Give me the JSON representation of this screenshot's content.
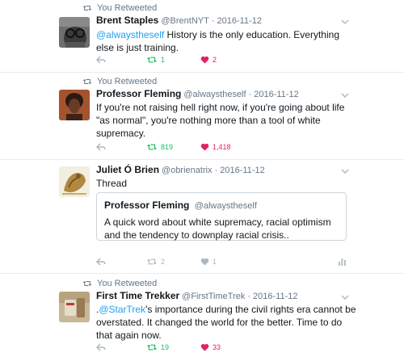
{
  "retweet_label": "You Retweeted",
  "tweets": [
    {
      "retweeted": true,
      "name": "Brent Staples",
      "handle": "@BrentNYT",
      "dot": "·",
      "date": "2016-11-12",
      "text_mention": "@alwaystheself",
      "text_rest": " History is the only education. Everything else is just training.",
      "retweets": "1",
      "likes": "2"
    },
    {
      "retweeted": true,
      "name": "Professor Fleming",
      "handle": "@alwaystheself",
      "dot": "·",
      "date": "2016-11-12",
      "text": "If you're not raising hell right now, if you're going about life \"as normal\", you're nothing more than a tool of white supremacy.",
      "retweets": "819",
      "likes": "1,418"
    },
    {
      "retweeted": false,
      "name": "Juliet Ó Brien",
      "handle": "@obrienatrix",
      "dot": "·",
      "date": "2016-11-12",
      "text": "Thread",
      "quote": {
        "name": "Professor Fleming",
        "handle": "@alwaystheself",
        "text": "A quick word about white supremacy, racial optimism and the tendency to downplay racial crisis.."
      },
      "retweets": "2",
      "likes": "1"
    },
    {
      "retweeted": true,
      "name": "First Time Trekker",
      "handle": "@FirstTimeTrek",
      "dot": "·",
      "date": "2016-11-12",
      "text_pre": ".",
      "text_mention": "@StarTrek",
      "text_rest": "'s importance during the civil rights era cannot be overstated. It changed the world for the better. Time to do that again now.",
      "retweets": "19",
      "likes": "33"
    }
  ],
  "colors": {
    "accent_blue": "#1da1f2",
    "retweet_green": "#17bf63",
    "like_red": "#e0245e",
    "muted": "#657786",
    "icon_gray": "#aab8c2"
  },
  "icons": [
    "retweet-icon",
    "reply-icon",
    "heart-icon",
    "chevron-down-icon",
    "analytics-icon"
  ]
}
